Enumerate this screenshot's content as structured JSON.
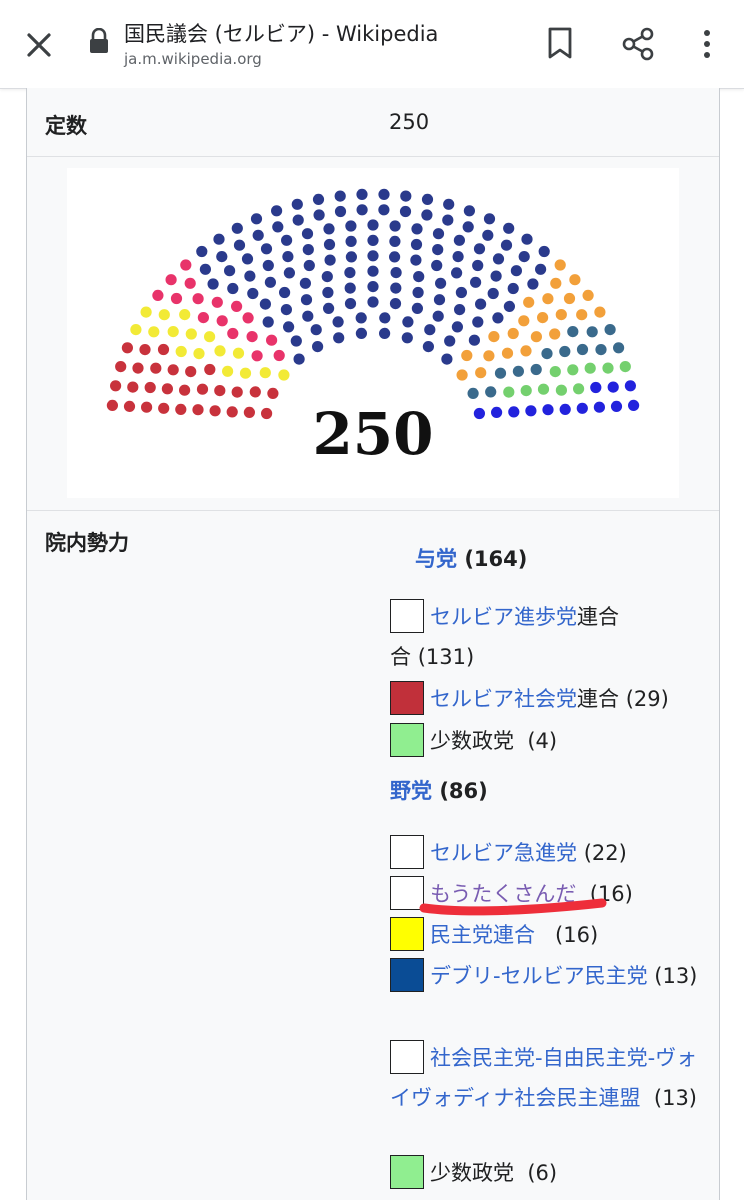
{
  "browser": {
    "title": "国民議会 (セルビア) - Wikipedia",
    "url": "ja.m.wikipedia.org",
    "icons": [
      "close-icon",
      "lock-icon",
      "bookmark-icon",
      "share-icon",
      "more-vert-icon"
    ]
  },
  "infobox": {
    "seats_label": "定数",
    "seats_value": "250",
    "power_label": "院内勢力",
    "chart_data": {
      "type": "parliament",
      "total": 250,
      "label": "250",
      "series": [
        {
          "name": "セルビア社会党連合",
          "seats": 29,
          "color": "#c8323c"
        },
        {
          "name": "民主党連合",
          "seats": 16,
          "color": "#f2ea36"
        },
        {
          "name": "もうたくさんだ",
          "seats": 16,
          "color": "#e8336a"
        },
        {
          "name": "セルビア進歩党連合",
          "seats": 131,
          "color": "#2a3a8c"
        },
        {
          "name": "セルビア急進党",
          "seats": 22,
          "color": "#f2a03a"
        },
        {
          "name": "デブリ-セルビア民主党",
          "seats": 13,
          "color": "#3a6a8c"
        },
        {
          "name": "少数政党",
          "seats": 10,
          "color": "#74d06e"
        },
        {
          "name": "社会民主党-自由民主党-ヴォイヴォディナ社会民主連盟",
          "seats": 13,
          "color": "#2222dd"
        }
      ]
    },
    "ruling": {
      "name": "与党",
      "count": "(164)",
      "parties": [
        {
          "link": "セルビア進歩党",
          "rest": "連合",
          "count": "(131)",
          "swatch": "#ffffff"
        },
        {
          "link": "セルビア社会党",
          "rest": "連合",
          "count": "(29)",
          "swatch": "#c1303a"
        },
        {
          "link": "",
          "rest": "少数政党",
          "count": "(4)",
          "swatch": "#90ee90"
        }
      ]
    },
    "opposition": {
      "name": "野党",
      "count": "(86)",
      "parties": [
        {
          "link": "セルビア急進党",
          "count": "(22)",
          "swatch": "#ffffff"
        },
        {
          "link": "もうたくさんだ",
          "count": "(16)",
          "swatch": "#ffffff"
        },
        {
          "link": "民主党連合",
          "count": "(16)",
          "swatch": "#ffff00"
        },
        {
          "link": "デブリ-セルビア民主党",
          "count": "(13)",
          "swatch": "#0a4c95"
        },
        {
          "link": "社会民主党-自由民主党-ヴォイヴォディナ社会民主連盟",
          "count": "(13)",
          "swatch": "#ffffff"
        },
        {
          "link": "",
          "rest": "少数政党",
          "count": "(6)",
          "swatch": "#90ee90"
        }
      ]
    }
  }
}
